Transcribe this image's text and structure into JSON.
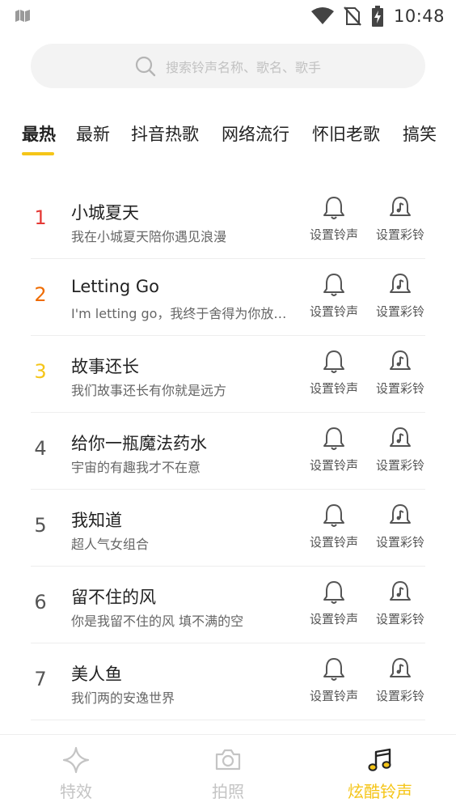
{
  "status_bar": {
    "time": "10:48"
  },
  "search": {
    "placeholder": "搜索铃声名称、歌名、歌手"
  },
  "tabs": [
    {
      "label": "最热",
      "active": true
    },
    {
      "label": "最新",
      "active": false
    },
    {
      "label": "抖音热歌",
      "active": false
    },
    {
      "label": "网络流行",
      "active": false
    },
    {
      "label": "怀旧老歌",
      "active": false
    },
    {
      "label": "搞笑",
      "active": false
    }
  ],
  "actions": {
    "set_ringtone": "设置铃声",
    "set_color_ring": "设置彩铃"
  },
  "songs": [
    {
      "rank": "1",
      "title": "小城夏天",
      "subtitle": "我在小城夏天陪你遇见浪漫",
      "rank_color": "#e53935"
    },
    {
      "rank": "2",
      "title": "Letting Go",
      "subtitle": "I'm letting go，我终于舍得为你放开手",
      "rank_color": "#ef6c00"
    },
    {
      "rank": "3",
      "title": "故事还长",
      "subtitle": "我们故事还长有你就是远方",
      "rank_color": "#f5c518"
    },
    {
      "rank": "4",
      "title": "给你一瓶魔法药水",
      "subtitle": "宇宙的有趣我才不在意",
      "rank_color": "#555555"
    },
    {
      "rank": "5",
      "title": "我知道",
      "subtitle": "超人气女组合",
      "rank_color": "#555555"
    },
    {
      "rank": "6",
      "title": "留不住的风",
      "subtitle": "你是我留不住的风 填不满的空",
      "rank_color": "#555555"
    },
    {
      "rank": "7",
      "title": "美人鱼",
      "subtitle": "我们两的安逸世界",
      "rank_color": "#555555"
    }
  ],
  "bottom_nav": [
    {
      "label": "特效",
      "icon": "sparkle-icon",
      "active": false
    },
    {
      "label": "拍照",
      "icon": "camera-icon",
      "active": false
    },
    {
      "label": "炫酷铃声",
      "icon": "music-note-icon",
      "active": true
    }
  ],
  "colors": {
    "accent": "#f5c518",
    "rank_1": "#e53935",
    "rank_2": "#ef6c00",
    "rank_3": "#f5c518"
  }
}
